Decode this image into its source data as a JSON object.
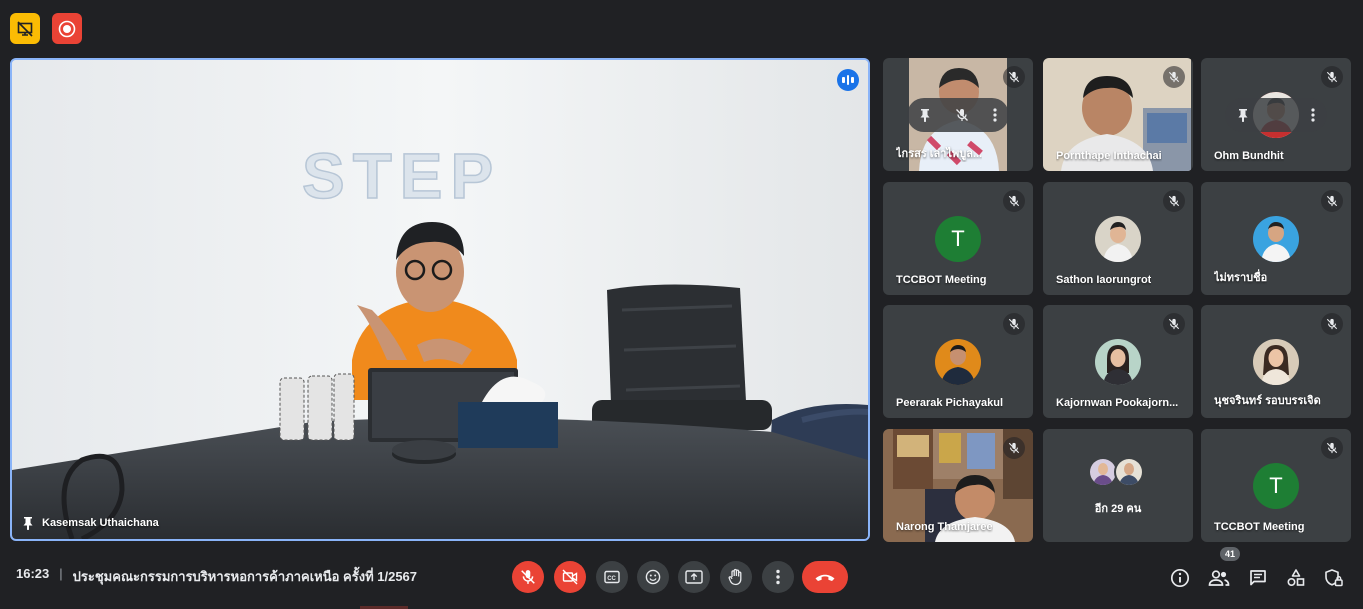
{
  "meeting": {
    "time": "16:23",
    "separator": "|",
    "title": "ประชุมคณะกรรมการบริหารหอการค้าภาคเหนือ ครั้งที่ 1/2567"
  },
  "top_badges": [
    {
      "name": "presenting",
      "icon": "presentation-off-icon",
      "color": "#fbbc04"
    },
    {
      "name": "recording",
      "icon": "record-icon",
      "color": "#ea4335"
    }
  ],
  "main_speaker": {
    "name": "Kasemsak Uthaichana",
    "pinned": true,
    "speaking": true,
    "backdrop_logo": "STEP"
  },
  "participants": [
    {
      "name": "ไกรสร เลาหไพบูลย์",
      "display": "ไกรสร เล่าไพบูล...",
      "type": "video",
      "muted": true,
      "hover_controls": true
    },
    {
      "name": "Pornthape Inthachai",
      "type": "video",
      "muted": true
    },
    {
      "name": "Ohm Bundhit",
      "type": "photo",
      "muted": true,
      "hover_controls": true
    },
    {
      "name": "TCCBOT Meeting",
      "type": "letter",
      "letter": "T",
      "color": "#1e7e34",
      "muted": true
    },
    {
      "name": "Sathon Iaorungrot",
      "type": "photo",
      "muted": true
    },
    {
      "name": "ไม่ทราบชื่อ",
      "type": "photo",
      "muted": true
    },
    {
      "name": "Peerarak Pichayakul",
      "type": "photo",
      "muted": true
    },
    {
      "name": "Kajornwan Pookajorn...",
      "type": "photo",
      "muted": true
    },
    {
      "name": "นุชจรินทร์ รอบบรรเจิด",
      "type": "photo",
      "muted": true
    },
    {
      "name": "Narong Thamjaree",
      "type": "video",
      "muted": true
    },
    {
      "name": "others",
      "type": "more",
      "label": "อีก 29 คน"
    },
    {
      "name": "TCCBOT Meeting",
      "type": "letter",
      "letter": "T",
      "color": "#1e7e34",
      "muted": true
    }
  ],
  "controls": [
    {
      "name": "microphone-toggle",
      "icon": "mic-off-icon",
      "state": "off"
    },
    {
      "name": "camera-toggle",
      "icon": "videocam-off-icon",
      "state": "off"
    },
    {
      "name": "captions-toggle",
      "icon": "closed-caption-icon"
    },
    {
      "name": "reactions",
      "icon": "emoji-icon"
    },
    {
      "name": "present-screen",
      "icon": "present-to-all-icon"
    },
    {
      "name": "raise-hand",
      "icon": "hand-icon"
    },
    {
      "name": "more-options",
      "icon": "more-vert-icon"
    },
    {
      "name": "leave-call",
      "icon": "call-end-icon"
    }
  ],
  "right_panel": {
    "participant_count": "41",
    "icons": [
      "info-icon",
      "people-icon",
      "chat-icon",
      "activities-icon",
      "host-controls-icon"
    ]
  },
  "colors": {
    "background": "#202124",
    "tile": "#3c4043",
    "accent": "#8ab4f8",
    "danger": "#ea4335"
  }
}
